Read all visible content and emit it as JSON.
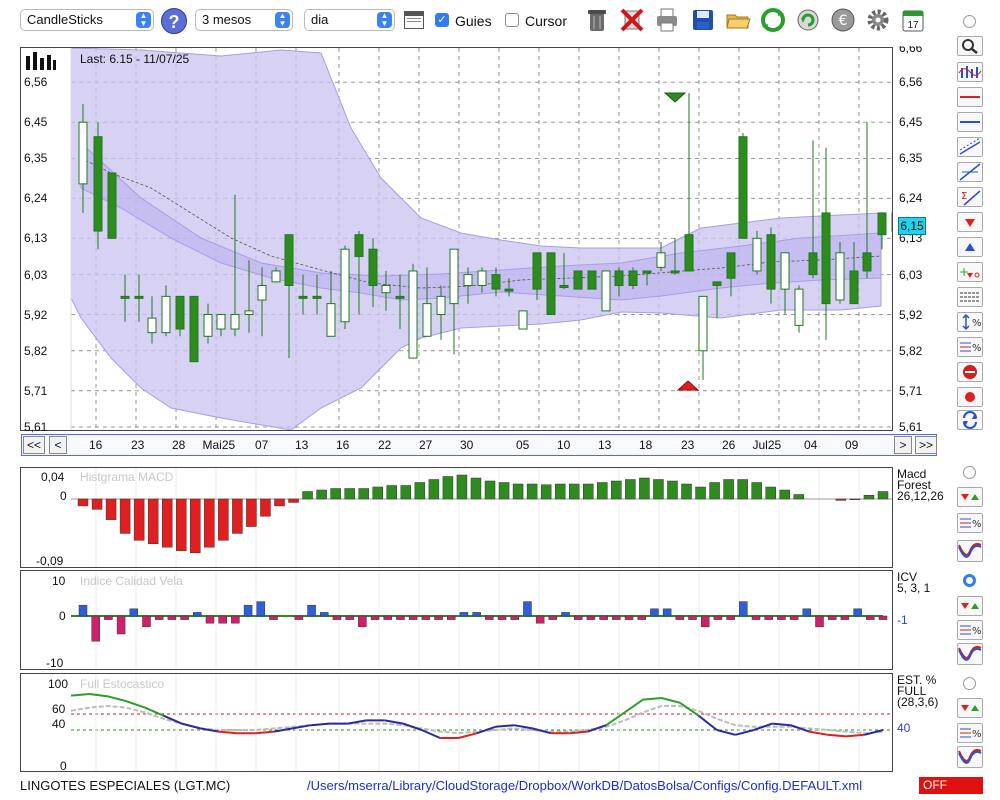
{
  "toolbar": {
    "chart_type": "CandleSticks",
    "period": "3 mesos",
    "interval": "dia",
    "guides_label": "Guies",
    "guides_checked": true,
    "cursor_label": "Cursor",
    "cursor_checked": false,
    "icons": [
      "help-icon",
      "sheet-icon",
      "trash-icon",
      "delete-icon",
      "print-icon",
      "save-icon",
      "open-folder-icon",
      "refresh-icon",
      "reload-icon",
      "currency-icon",
      "settings-icon",
      "calendar-icon"
    ],
    "calendar_day": "17"
  },
  "main_chart": {
    "last_label": "Last: 6.15 - 11/07/25",
    "price_tag": "6,15",
    "y_ticks_left": [
      "6,56",
      "6,45",
      "6,35",
      "6,24",
      "6,13",
      "6,03",
      "5,92",
      "5,82",
      "5,71",
      "5,61"
    ],
    "y_ticks_right": [
      "6,66",
      "6,56",
      "6,45",
      "6,35",
      "6,24",
      "6,13",
      "6,03",
      "5,92",
      "5,82",
      "5,71",
      "5,61"
    ],
    "x_labels": [
      "16",
      "23",
      "28",
      "Mai25",
      "07",
      "13",
      "16",
      "22",
      "27",
      "30",
      "05",
      "10",
      "13",
      "18",
      "23",
      "26",
      "Jul25",
      "04",
      "09"
    ],
    "nav": {
      "first": "<<",
      "prev": "<",
      "next": ">",
      "last": ">>"
    }
  },
  "macd_panel": {
    "title": "Histgrama MACD",
    "y_ticks": [
      "0,04",
      "0",
      "-0,09"
    ],
    "right_label_1": "Macd",
    "right_label_2": "Forest",
    "right_params": "26,12,26"
  },
  "icv_panel": {
    "title": "Indice Calidad Vela",
    "y_ticks": [
      "10",
      "0",
      "-10"
    ],
    "right_label": "ICV",
    "right_params": "5, 3, 1",
    "right_value": "-1"
  },
  "stoch_panel": {
    "title": "Full Estocastico",
    "y_ticks": [
      "100",
      "60",
      "40",
      "0"
    ],
    "right_label_1": "EST. %",
    "right_label_2": "FULL",
    "right_params": "(28,3,6)",
    "right_value": "40"
  },
  "status": {
    "ticker": "LINGOTES ESPECIALES (LGT.MC)",
    "path": "/Users/mserra/Library/CloudStorage/Dropbox/WorkDB/DatosBolsa/Configs/Config.DEFAULT.xml",
    "state": "OFF"
  },
  "colors": {
    "up": "#2e8b1e",
    "down_hollow": "#ffffff",
    "band": "#c9c2f0",
    "macd_pos": "#2e8b1e",
    "macd_neg": "#e02020",
    "icv_pos": "#2f5fd8",
    "icv_neg": "#d0206a",
    "price_tag": "#22d3ee",
    "off_bg": "#e01010"
  },
  "chart_data": [
    {
      "type": "candlestick",
      "title": "",
      "x": [
        "16",
        "23",
        "28",
        "Mai25",
        "07",
        "13",
        "16",
        "22",
        "27",
        "30",
        "05",
        "10",
        "13",
        "18",
        "23",
        "26",
        "Jul25",
        "04",
        "09"
      ],
      "y_range": [
        5.61,
        6.66
      ],
      "last_value": 6.15,
      "close_approx": [
        6.28,
        6.24,
        6.18,
        6.0,
        5.91,
        5.96,
        5.88,
        5.88,
        5.92,
        6.07,
        6.11,
        6.03,
        6.04,
        5.96,
        6.08,
        6.05,
        6.1,
        6.14,
        6.15
      ],
      "signals": [
        "sell-marker-23",
        "buy-marker-23"
      ]
    },
    {
      "type": "bar",
      "title": "Histgrama MACD",
      "ylim": [
        -0.09,
        0.04
      ],
      "values": [
        -0.01,
        -0.015,
        -0.03,
        -0.05,
        -0.06,
        -0.065,
        -0.07,
        -0.075,
        -0.078,
        -0.07,
        -0.06,
        -0.05,
        -0.04,
        -0.025,
        -0.01,
        -0.005,
        0.01,
        0.012,
        0.014,
        0.014,
        0.014,
        0.016,
        0.018,
        0.018,
        0.022,
        0.026,
        0.03,
        0.032,
        0.028,
        0.024,
        0.022,
        0.02,
        0.02,
        0.019,
        0.02,
        0.02,
        0.02,
        0.022,
        0.024,
        0.026,
        0.028,
        0.026,
        0.024,
        0.02,
        0.016,
        0.022,
        0.026,
        0.026,
        0.022,
        0.016,
        0.012,
        0.006,
        0.0,
        0.0,
        -0.002,
        -0.001,
        0.005,
        0.01
      ]
    },
    {
      "type": "bar",
      "title": "Indice Calidad Vela",
      "ylim": [
        -10,
        10
      ],
      "values": [
        3,
        -7,
        -1,
        -5,
        2,
        -3,
        -1,
        -1,
        -1,
        1,
        -2,
        -2,
        -2,
        3,
        4,
        -1,
        0,
        -1,
        3,
        1,
        -1,
        -1,
        -3,
        -1,
        -1,
        -1,
        -1,
        -1,
        -1,
        -1,
        1,
        1,
        -1,
        -1,
        -1,
        4,
        -2,
        -1,
        1,
        -1,
        -1,
        -1,
        -1,
        -1,
        -1,
        2,
        2,
        -1,
        -1,
        -3,
        -1,
        -1,
        4,
        -1,
        -1,
        -1,
        -1,
        2,
        -3,
        -1,
        -1,
        2,
        -1,
        -1
      ]
    },
    {
      "type": "line",
      "title": "Full Estocastico",
      "ylim": [
        0,
        100
      ],
      "series": [
        {
          "values": [
            83,
            85,
            82,
            76,
            68,
            58,
            48,
            42,
            38,
            36,
            36,
            38,
            42,
            46,
            48,
            48,
            52,
            52,
            48,
            40,
            30,
            30,
            36,
            44,
            46,
            42,
            36,
            36,
            38,
            46,
            62,
            78,
            80,
            74,
            58,
            40,
            34,
            40,
            48,
            46,
            38,
            34,
            32,
            34,
            40
          ]
        },
        {
          "values": [
            64,
            68,
            70,
            68,
            62,
            54,
            48,
            42,
            40,
            40,
            40,
            42,
            44,
            46,
            48,
            48,
            48,
            48,
            46,
            42,
            38,
            36,
            38,
            40,
            42,
            40,
            38,
            38,
            40,
            44,
            52,
            62,
            70,
            70,
            64,
            54,
            46,
            44,
            44,
            44,
            42,
            40,
            38,
            36,
            38
          ]
        }
      ]
    }
  ]
}
